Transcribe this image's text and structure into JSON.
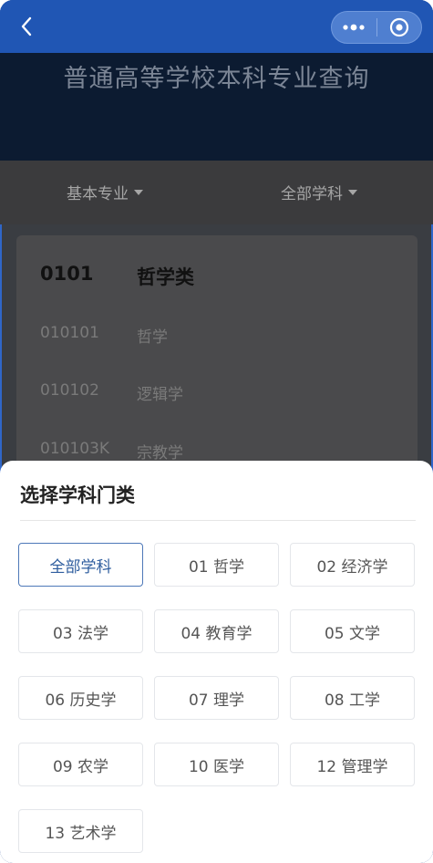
{
  "header": {
    "title": "普通高等学校本科专业查询"
  },
  "filters": {
    "type_label": "基本专业",
    "subject_label": "全部学科"
  },
  "card": {
    "group": {
      "code": "0101",
      "name": "哲学类"
    },
    "rows": [
      {
        "code": "010101",
        "name": "哲学"
      },
      {
        "code": "010102",
        "name": "逻辑学"
      },
      {
        "code": "010103K",
        "name": "宗教学"
      }
    ]
  },
  "sheet": {
    "title": "选择学科门类",
    "options": [
      {
        "label": "全部学科",
        "selected": true
      },
      {
        "label": "01 哲学",
        "selected": false
      },
      {
        "label": "02 经济学",
        "selected": false
      },
      {
        "label": "03 法学",
        "selected": false
      },
      {
        "label": "04 教育学",
        "selected": false
      },
      {
        "label": "05 文学",
        "selected": false
      },
      {
        "label": "06 历史学",
        "selected": false
      },
      {
        "label": "07 理学",
        "selected": false
      },
      {
        "label": "08 工学",
        "selected": false
      },
      {
        "label": "09 农学",
        "selected": false
      },
      {
        "label": "10 医学",
        "selected": false
      },
      {
        "label": "12 管理学",
        "selected": false
      },
      {
        "label": "13 艺术学",
        "selected": false
      }
    ]
  },
  "colors": {
    "nav": "#2056b4",
    "hero": "#0c1b31",
    "accent": "#2e5d9e"
  }
}
